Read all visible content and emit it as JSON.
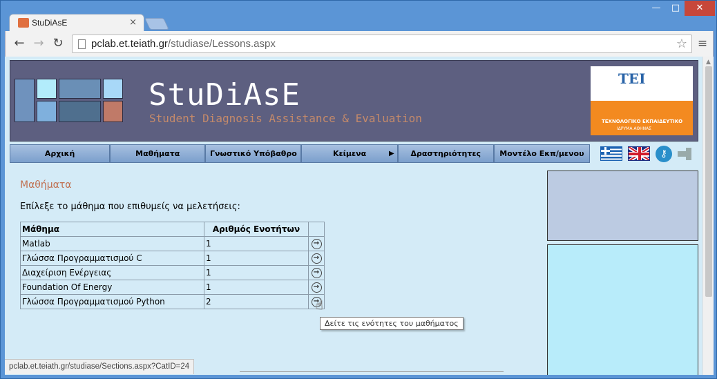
{
  "browser": {
    "tab_title": "StuDiAsE",
    "tab_close": "×",
    "url_host": "pclab.et.teiath.gr",
    "url_path": "/studiase/Lessons.aspx",
    "status_url": "pclab.et.teiath.gr/studiase/Sections.aspx?CatID=24",
    "window_min": "—",
    "window_max": "□",
    "window_close": "✕"
  },
  "header": {
    "brand": "StuDiAsE",
    "subtitle": "Student Diagnosis Assistance & Evaluation",
    "logo_mark": "ΤΕΙ",
    "logo_text": "ΤΕΧΝΟΛΟΓΙΚΟ ΕΚΠΑΙΔΕΥΤΙΚΟ",
    "logo_text2": "ΙΔΡΥΜΑ ΑΘΗΝΑΣ"
  },
  "nav": {
    "items": [
      {
        "label": "Αρχική"
      },
      {
        "label": "Μαθήματα"
      },
      {
        "label": "Γνωστικό Υπόβαθρο"
      },
      {
        "label": "Κείμενα"
      },
      {
        "label": "Δραστηριότητες"
      },
      {
        "label": "Μοντέλο Εκπ/μενου"
      }
    ]
  },
  "content": {
    "title": "Μαθήματα",
    "instructions": "Επίλεξε το μάθημα που επιθυμείς να μελετήσεις:",
    "table": {
      "headers": [
        "Μάθημα",
        "Αριθμός Ενοτήτων"
      ],
      "rows": [
        {
          "name": "Matlab",
          "sections": "1"
        },
        {
          "name": "Γλώσσα Προγραμματισμού C",
          "sections": "1"
        },
        {
          "name": "Διαχείριση Ενέργειας",
          "sections": "1"
        },
        {
          "name": "Foundation Of Energy",
          "sections": "1"
        },
        {
          "name": "Γλώσσα Προγραμματισμού Python",
          "sections": "2"
        }
      ]
    },
    "tooltip": "Δείτε τις ενότητες του μαθήματος"
  },
  "colors": {
    "banner": "#5d5f80",
    "page_bg": "#d4ebf7",
    "title_accent": "#c07050"
  }
}
